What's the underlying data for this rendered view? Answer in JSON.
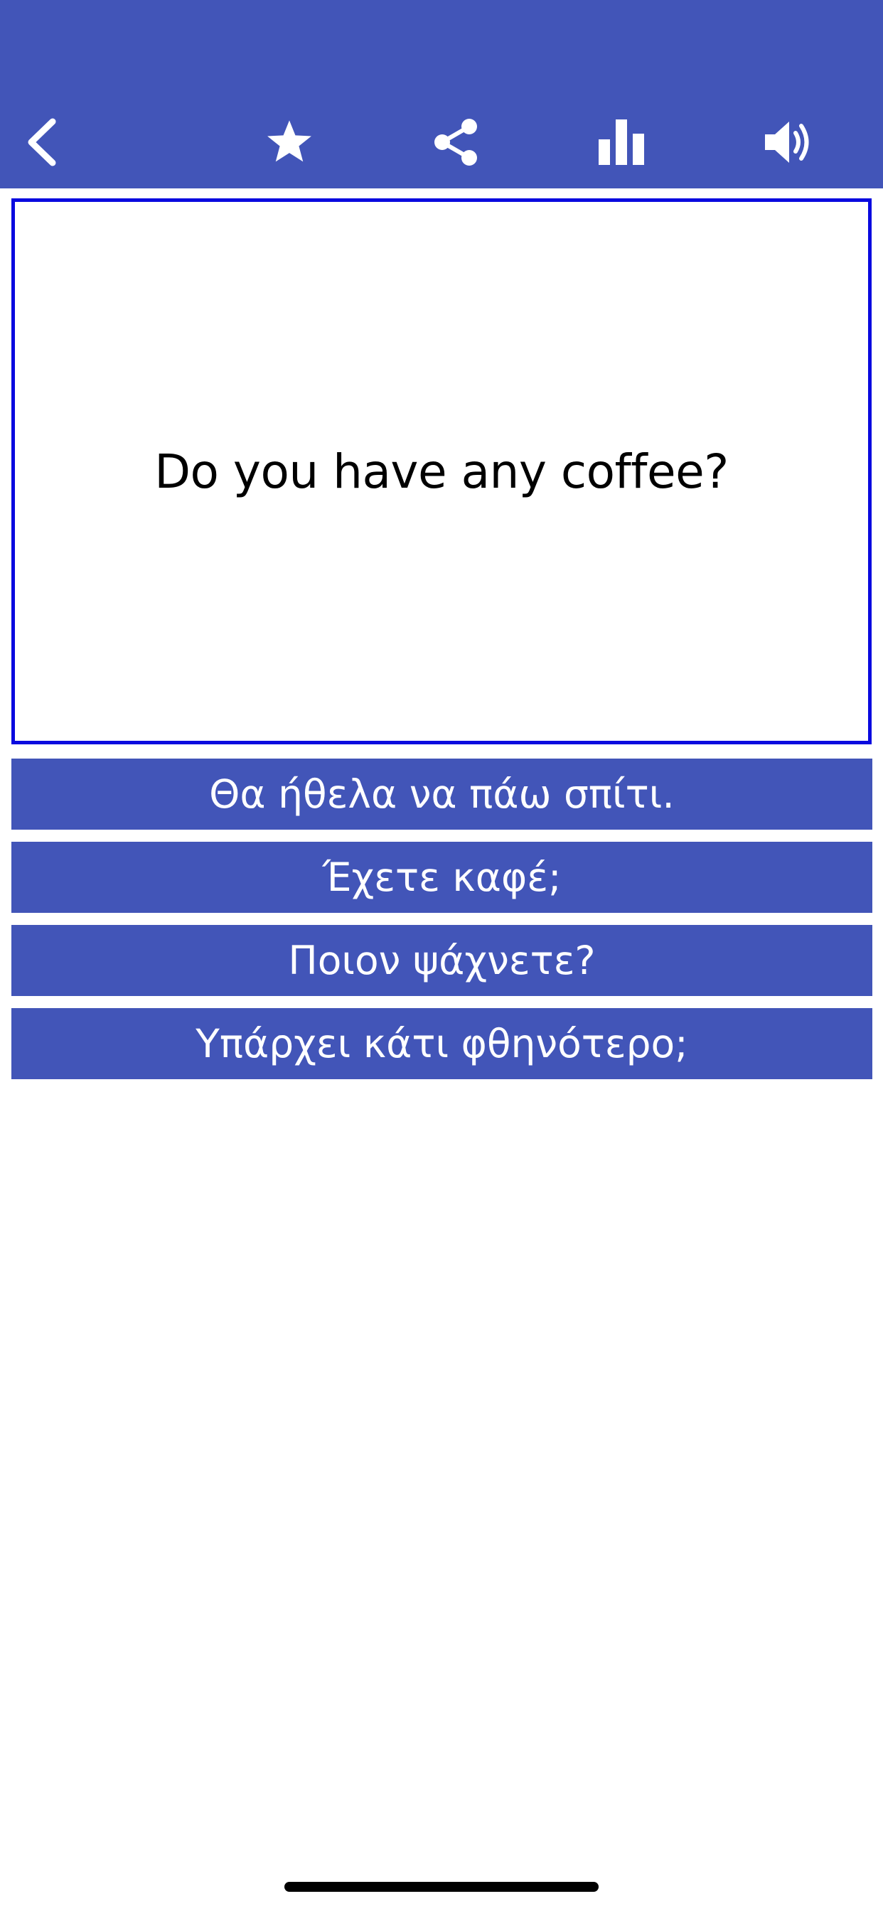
{
  "colors": {
    "header_bg": "#4255b8",
    "card_border": "#0a0adf",
    "answer_bg": "#4255b8",
    "icon": "#ffffff"
  },
  "toolbar": {
    "icons": [
      "chevron-left-icon",
      "star-icon",
      "share-icon",
      "bar-chart-icon",
      "speaker-icon"
    ]
  },
  "question": {
    "text": "Do you have any coffee?"
  },
  "answers": [
    {
      "label": "Θα ήθελα να πάω σπίτι."
    },
    {
      "label": "Έχετε καφέ;"
    },
    {
      "label": "Ποιον ψάχνετε?"
    },
    {
      "label": "Υπάρχει κάτι φθηνότερο;"
    }
  ]
}
